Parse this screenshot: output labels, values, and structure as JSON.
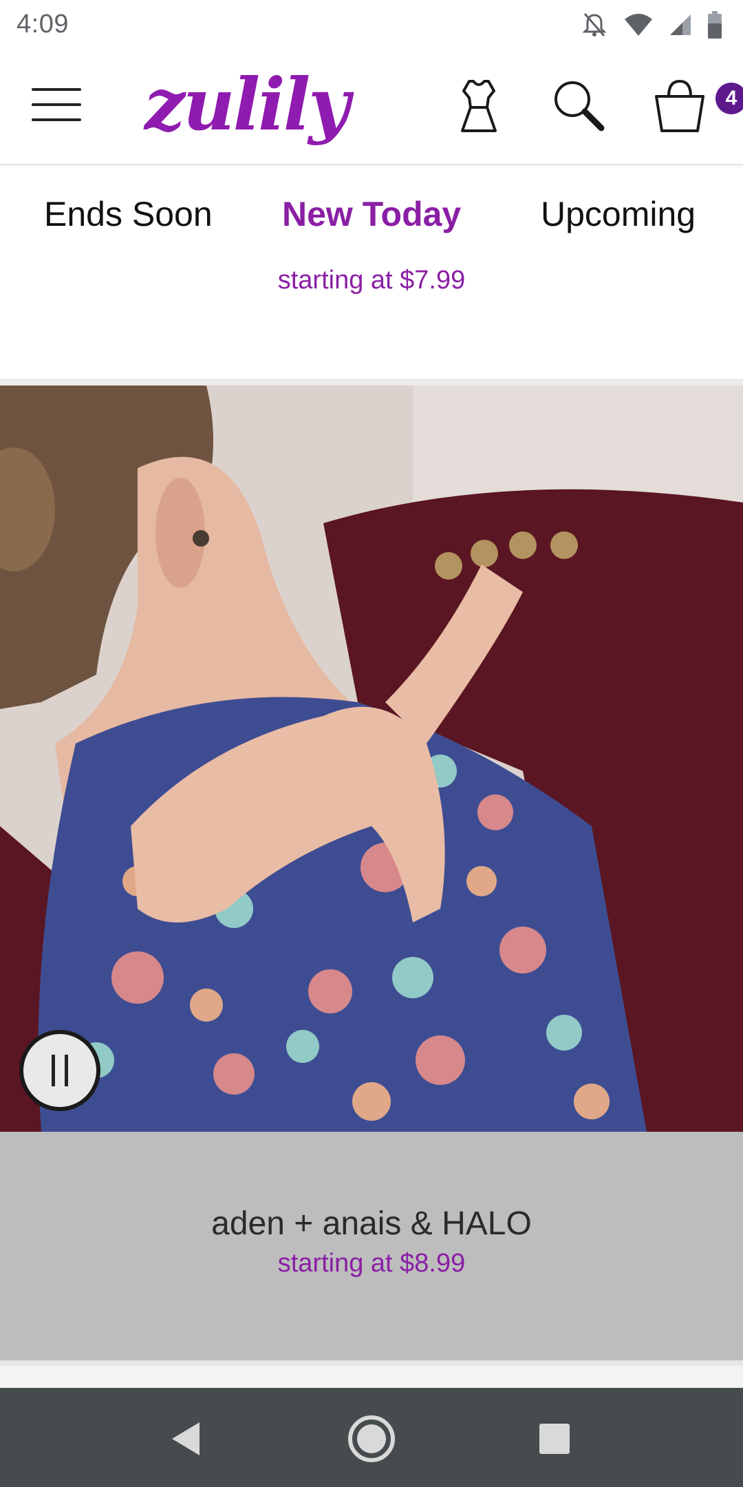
{
  "status_bar": {
    "time": "4:09",
    "icons": [
      "notifications-off-icon",
      "wifi-icon",
      "signal-icon",
      "battery-icon"
    ]
  },
  "header": {
    "logo": "zulily",
    "icons": [
      "menu-icon",
      "dress-icon",
      "search-icon",
      "shopping-bag-icon"
    ],
    "cart_count": "4"
  },
  "tabs": [
    {
      "label": "Ends Soon",
      "active": false
    },
    {
      "label": "New Today",
      "active": true
    },
    {
      "label": "Upcoming",
      "active": false
    }
  ],
  "previous_event": {
    "price": "starting at $7.99"
  },
  "event": {
    "name": "aden + anais & HALO",
    "price": "starting at $8.99"
  },
  "colors": {
    "brand_purple": "#8a1fa5",
    "badge_purple": "#5e1a8d",
    "caption_bg": "#bdbdbd",
    "nav_bar": "#464b4e"
  }
}
